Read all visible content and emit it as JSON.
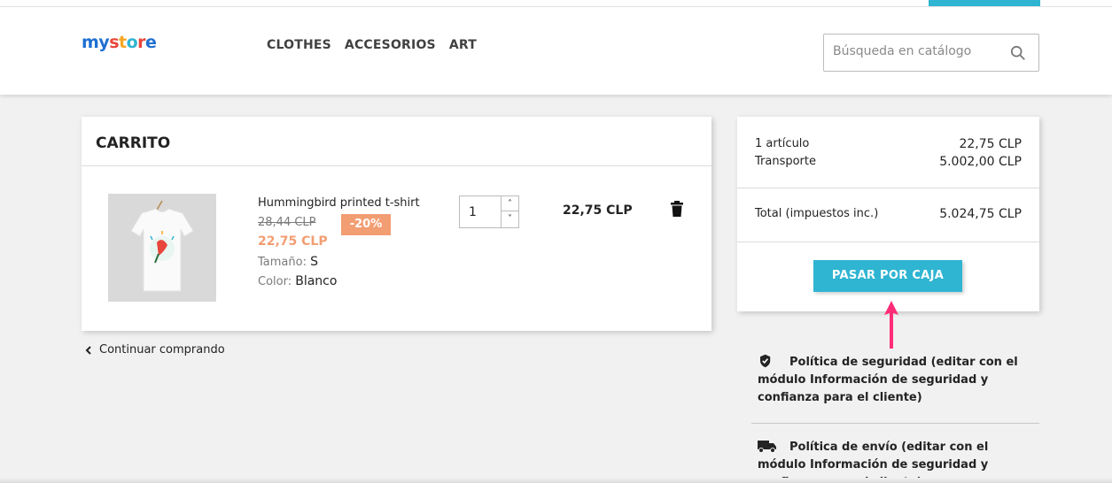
{
  "header": {
    "logo_parts": [
      {
        "text": "my",
        "color": "#1f6fd1"
      },
      {
        "text": " ",
        "color": "#232323"
      },
      {
        "text": "s",
        "color": "#e8463c"
      },
      {
        "text": "t",
        "color": "#f5a623"
      },
      {
        "text": "o",
        "color": "#2fb5d2"
      },
      {
        "text": "r",
        "color": "#e8463c"
      },
      {
        "text": "e",
        "color": "#1f6fd1"
      }
    ],
    "nav": [
      "CLOTHES",
      "ACCESORIOS",
      "ART"
    ],
    "search_placeholder": "Búsqueda en catálogo",
    "search_icon": "search-icon",
    "accent_color": "#2fb5d2"
  },
  "cart": {
    "title": "CARRITO",
    "items": [
      {
        "name": "Hummingbird printed t-shirt",
        "old_price": "28,44 CLP",
        "discount": "-20%",
        "price": "22,75 CLP",
        "size_label": "Tamaño:",
        "size_value": "S",
        "color_label": "Color:",
        "color_value": "Blanco",
        "quantity": "1",
        "total": "22,75 CLP"
      }
    ],
    "continue_label": "Continuar comprando",
    "discount_color": "#f39d72"
  },
  "summary": {
    "items_label": "1 artículo",
    "items_value": "22,75 CLP",
    "shipping_label": "Transporte",
    "shipping_value": "5.002,00 CLP",
    "total_label": "Total (impuestos inc.)",
    "total_value": "5.024,75 CLP",
    "checkout_label": "PASAR POR CAJA"
  },
  "reassurance": [
    {
      "icon": "shield-icon",
      "text": "Política de seguridad (editar con el módulo Información de seguridad y confianza para el cliente)"
    },
    {
      "icon": "truck-icon",
      "text": "Política de envío (editar con el módulo Información de seguridad y confianza para el cliente)"
    }
  ],
  "annotation_color": "#ff2d78"
}
